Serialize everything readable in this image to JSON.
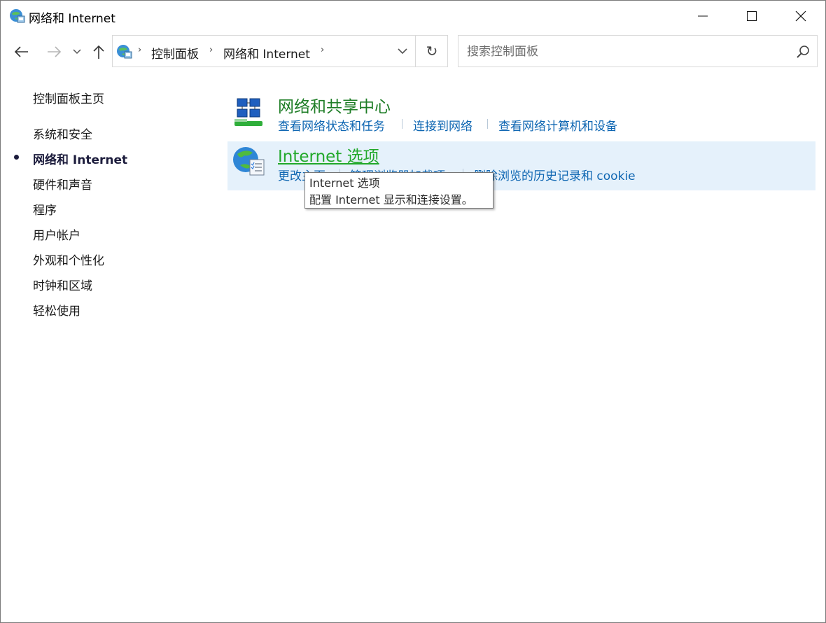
{
  "window": {
    "title": "网络和 Internet"
  },
  "nav": {
    "back_icon": "arrow-left-icon",
    "forward_icon": "arrow-right-icon",
    "recent_icon": "chevron-down-icon",
    "up_icon": "arrow-up-icon"
  },
  "address": {
    "breadcrumbs": [
      "控制面板",
      "网络和 Internet"
    ],
    "refresh_glyph": "↻"
  },
  "search": {
    "placeholder": "搜索控制面板",
    "value": ""
  },
  "sidebar": {
    "home": "控制面板主页",
    "items": [
      {
        "label": "系统和安全",
        "current": false
      },
      {
        "label": "网络和 Internet",
        "current": true
      },
      {
        "label": "硬件和声音",
        "current": false
      },
      {
        "label": "程序",
        "current": false
      },
      {
        "label": "用户帐户",
        "current": false
      },
      {
        "label": "外观和个性化",
        "current": false
      },
      {
        "label": "时钟和区域",
        "current": false
      },
      {
        "label": "轻松使用",
        "current": false
      }
    ]
  },
  "categories": [
    {
      "title": "网络和共享中心",
      "icon": "network-sharing-center-icon",
      "links": [
        "查看网络状态和任务",
        "连接到网络",
        "查看网络计算机和设备"
      ]
    },
    {
      "title": "Internet 选项",
      "icon": "internet-options-icon",
      "links": [
        "更改主页",
        "管理浏览器加载项",
        "删除浏览的历史记录和 cookie"
      ]
    }
  ],
  "tooltip": {
    "title": "Internet 选项",
    "description": "配置 Internet 显示和连接设置。"
  },
  "colors": {
    "category_title": "#1e7d26",
    "category_title_hover": "#21a82a",
    "link": "#0e66b2",
    "hover_bg": "#e5f1fb"
  }
}
